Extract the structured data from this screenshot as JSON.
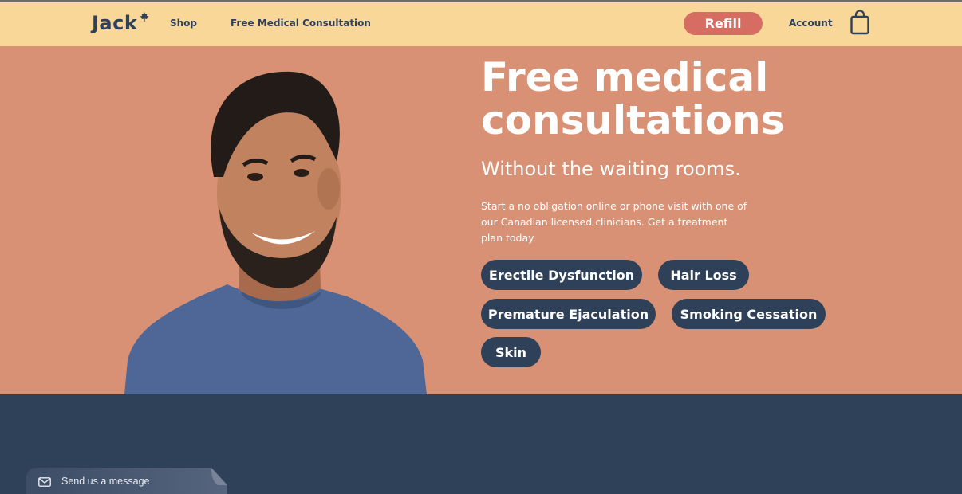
{
  "header": {
    "logo": "Jack",
    "nav": {
      "shop": "Shop",
      "consultation": "Free Medical Consultation"
    },
    "refill_label": "Refill",
    "account_label": "Account",
    "icons": {
      "logo_mark": "maple-leaf-icon",
      "cart": "shopping-bag-icon"
    }
  },
  "hero": {
    "title": "Free medical consultations",
    "subtitle": "Without the waiting rooms.",
    "body": "Start a no obligation online or phone visit with one of our Canadian licensed clinicians. Get a treatment plan today.",
    "categories": [
      "Erectile Dysfunction",
      "Hair Loss",
      "Premature Ejaculation",
      "Smoking Cessation",
      "Skin"
    ]
  },
  "chat_widget": {
    "label": "Send us a message",
    "icon": "envelope-icon"
  },
  "colors": {
    "header_bg": "#f8d799",
    "hero_bg": "#d89174",
    "navy": "#2f4059",
    "refill": "#d76c62",
    "white": "#ffffff"
  }
}
